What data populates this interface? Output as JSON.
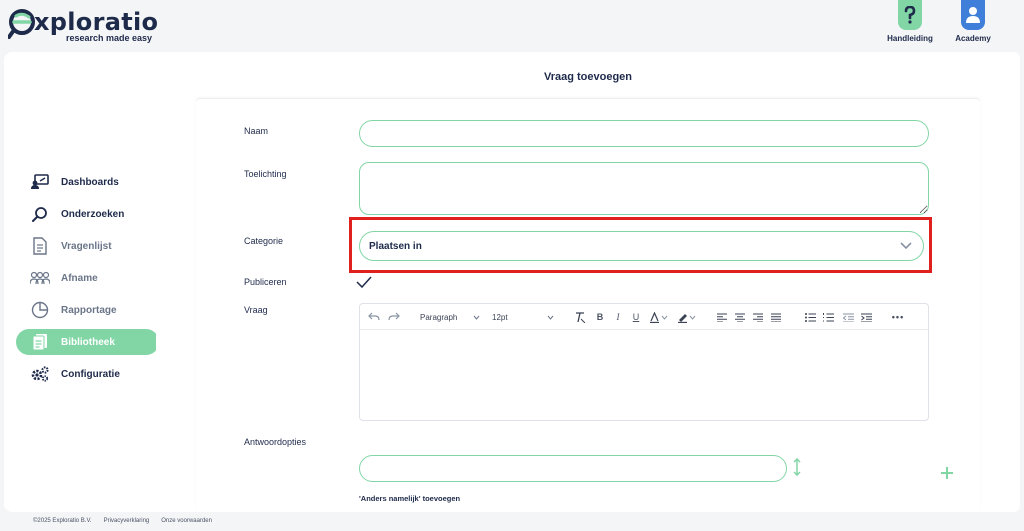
{
  "brand": {
    "name": "xploratio",
    "tagline": "research made easy",
    "logo_icon": "exploratio-e-magnifier-logo"
  },
  "header": {
    "help_buttons": [
      {
        "label": "Handleiding",
        "icon": "question-mark-icon",
        "color": "#82d6a6"
      },
      {
        "label": "Academy",
        "icon": "user-icon",
        "color": "#3f7fd9"
      }
    ]
  },
  "sidebar": {
    "items": [
      {
        "label": "Dashboards",
        "icon": "dashboard-icon",
        "state": "normal"
      },
      {
        "label": "Onderzoeken",
        "icon": "search-icon",
        "state": "normal"
      },
      {
        "label": "Vragenlijst",
        "icon": "document-icon",
        "state": "muted"
      },
      {
        "label": "Afname",
        "icon": "people-icon",
        "state": "muted"
      },
      {
        "label": "Rapportage",
        "icon": "pie-chart-icon",
        "state": "muted"
      },
      {
        "label": "Bibliotheek",
        "icon": "library-icon",
        "state": "active"
      },
      {
        "label": "Configuratie",
        "icon": "gears-icon",
        "state": "normal"
      }
    ],
    "active_color": "#82d6a6"
  },
  "main": {
    "title": "Vraag toevoegen",
    "labels": {
      "naam": "Naam",
      "toelichting": "Toelichting",
      "categorie": "Categorie",
      "publiceren": "Publiceren",
      "vraag": "Vraag",
      "antwoordopties": "Antwoordopties"
    },
    "values": {
      "naam": "",
      "toelichting": "",
      "categorie": "Plaatsen in",
      "antwoordoptie": ""
    },
    "publiceren_checked": true,
    "editor": {
      "block_format": "Paragraph",
      "font_size": "12pt",
      "content": ""
    },
    "anders_link": "'Anders namelijk' toevoegen"
  },
  "footer": {
    "copyright": "©2025 Exploratio B.V.",
    "links": [
      "Privacyverklaring",
      "Onze voorwaarden"
    ]
  },
  "colors": {
    "accent": "#82d6a6",
    "text": "#1e2a4a",
    "highlight": "#e0201c"
  }
}
